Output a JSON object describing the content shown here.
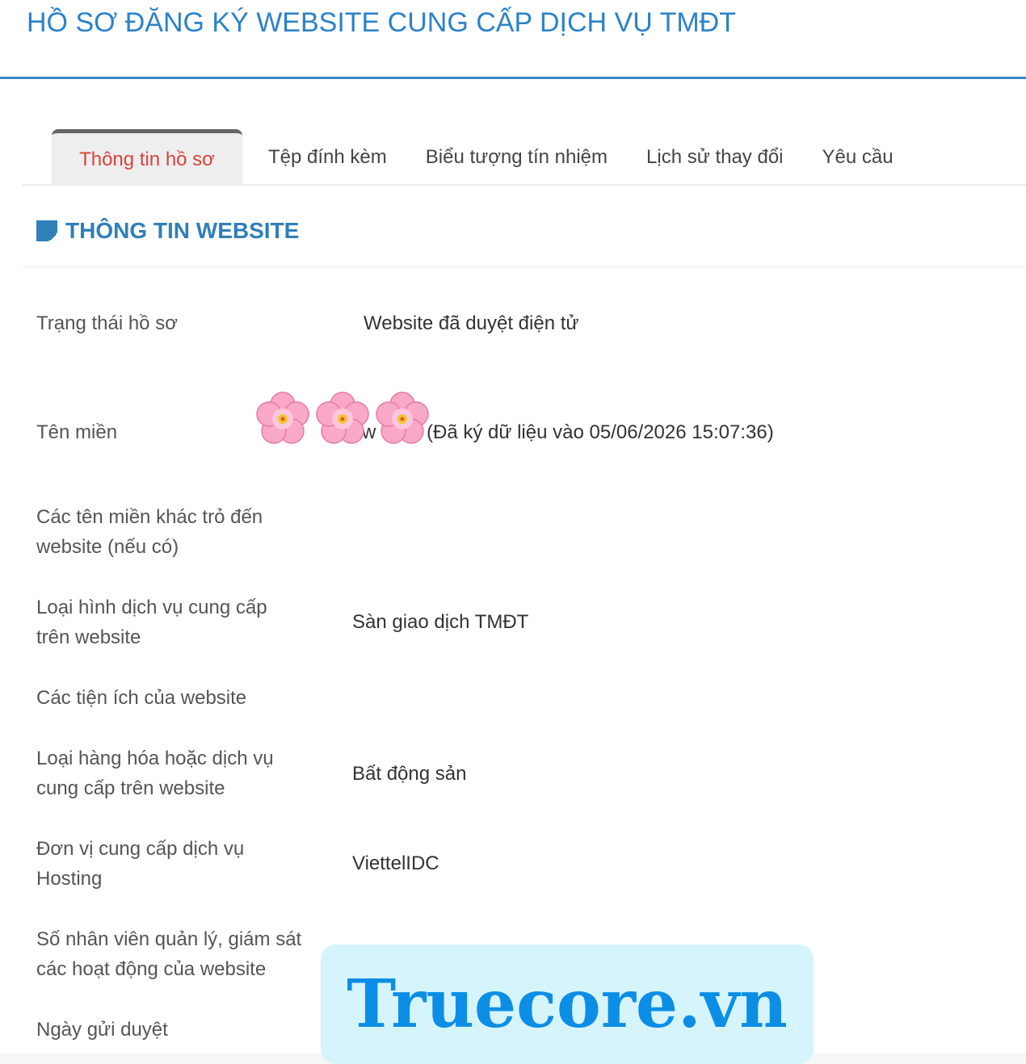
{
  "header": {
    "title": "HỒ SƠ ĐĂNG KÝ WEBSITE CUNG CẤP DỊCH VỤ TMĐT"
  },
  "tabs": [
    {
      "label": "Thông tin hồ sơ",
      "active": true
    },
    {
      "label": "Tệp đính kèm",
      "active": false
    },
    {
      "label": "Biểu tượng tín nhiệm",
      "active": false
    },
    {
      "label": "Lịch sử thay đổi",
      "active": false
    },
    {
      "label": "Yêu cầu",
      "active": false
    }
  ],
  "section": {
    "icon": "edit-note-icon",
    "title": "THÔNG TIN WEBSITE"
  },
  "fields": {
    "status": {
      "label": "Trạng thái hồ sơ",
      "value": "Website đã duyệt điện tử"
    },
    "domain": {
      "label": "Tên miền",
      "value": "(Đã ký dữ liệu vào 05/06/2026 15:07:36)",
      "partial_prefix": "w"
    },
    "other_domains": {
      "label_line1": "Các tên miền khác trỏ đến",
      "label_line2": "website (nếu có)",
      "value": ""
    },
    "service_type": {
      "label_line1": "Loại hình dịch vụ cung cấp",
      "label_line2": "trên website",
      "value": "Sàn giao dịch TMĐT"
    },
    "utilities": {
      "label": "Các tiện ích của website",
      "value": ""
    },
    "goods_type": {
      "label_line1": "Loại hàng hóa hoặc dịch vụ",
      "label_line2": "cung cấp trên website",
      "value": "Bất động sản"
    },
    "hosting": {
      "label_line1": "Đơn vị cung cấp dịch vụ",
      "label_line2": "Hosting",
      "value": "ViettelIDC"
    },
    "staff": {
      "label_line1": "Số nhân viên quản lý, giám sát",
      "label_line2": "các hoạt động của website",
      "value": ""
    },
    "submit_date": {
      "label": "Ngày gửi duyệt",
      "value": ""
    }
  },
  "overlay": {
    "flower_sticker": "cherry-blossom-icon",
    "watermark": "Truecore.vn",
    "watermark_bg": "#d6f4fb",
    "watermark_color": "#0c8ee6"
  },
  "colors": {
    "title": "#2c82c9",
    "active_tab": "#d9433b",
    "section": "#2f7fb8"
  }
}
